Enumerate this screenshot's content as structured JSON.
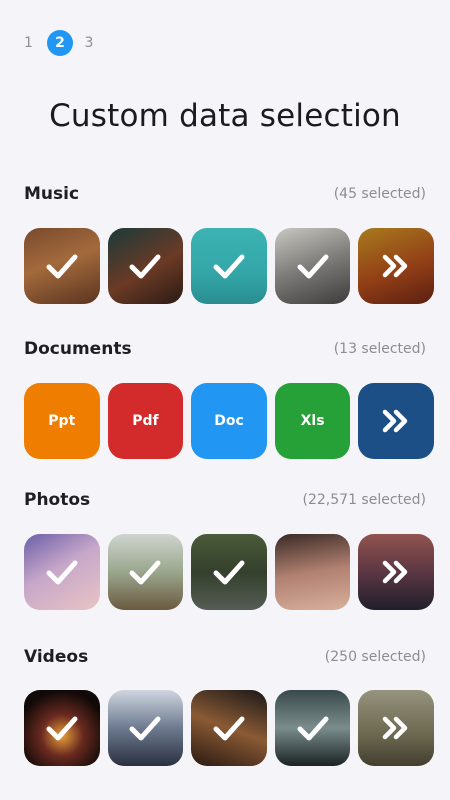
{
  "stepper": {
    "steps": [
      "1",
      "2",
      "3"
    ],
    "active_index": 1
  },
  "title": "Custom data selection",
  "sections": [
    {
      "label": "Music",
      "count_text": "(45 selected)",
      "tiles": [
        {
          "type": "image",
          "name": "music-banjo-player-thumb",
          "selected": true
        },
        {
          "type": "image",
          "name": "music-guitar-monkey-thumb",
          "selected": true
        },
        {
          "type": "image",
          "name": "music-feelings-turntable-thumb",
          "selected": true
        },
        {
          "type": "image",
          "name": "music-headphones-woman-thumb",
          "selected": true
        },
        {
          "type": "more",
          "name": "music-more-thumb"
        }
      ]
    },
    {
      "label": "Documents",
      "count_text": "(13 selected)",
      "tiles": [
        {
          "type": "doc",
          "label": "Ppt",
          "color": "#ef7d00"
        },
        {
          "type": "doc",
          "label": "Pdf",
          "color": "#d32b2b"
        },
        {
          "type": "doc",
          "label": "Doc",
          "color": "#2196f3"
        },
        {
          "type": "doc",
          "label": "Xls",
          "color": "#25a137"
        },
        {
          "type": "more",
          "color": "#1c4f86"
        }
      ]
    },
    {
      "label": "Photos",
      "count_text": "(22,571 selected)",
      "tiles": [
        {
          "type": "image",
          "name": "photo-woman-purple-thumb",
          "selected": true
        },
        {
          "type": "image",
          "name": "photo-umbrella-woman-thumb",
          "selected": true
        },
        {
          "type": "image",
          "name": "photo-man-jacket-thumb",
          "selected": true
        },
        {
          "type": "image",
          "name": "photo-woman-portrait-thumb",
          "selected": false
        },
        {
          "type": "more",
          "name": "photo-more-thumb"
        }
      ]
    },
    {
      "label": "Videos",
      "count_text": "(250 selected)",
      "tiles": [
        {
          "type": "image",
          "name": "video-explosion-thumb",
          "selected": true
        },
        {
          "type": "image",
          "name": "video-snow-woman-thumb",
          "selected": true
        },
        {
          "type": "image",
          "name": "video-hand-sunset-thumb",
          "selected": true
        },
        {
          "type": "image",
          "name": "video-city-ruins-thumb",
          "selected": true
        },
        {
          "type": "more",
          "name": "video-more-thumb"
        }
      ]
    }
  ],
  "colors": {
    "accent": "#2196f3",
    "background": "#f5f5f9",
    "muted_text": "#8c8c94"
  }
}
